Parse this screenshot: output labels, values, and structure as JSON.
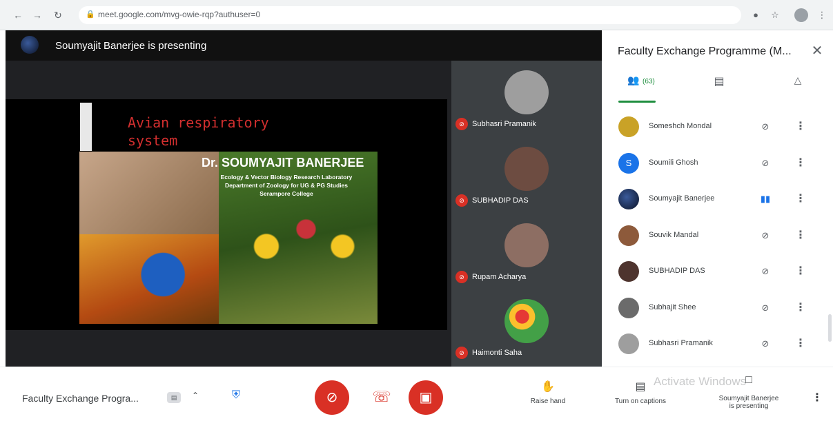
{
  "browser": {
    "url": "meet.google.com/mvg-owie-rqp?authuser=0",
    "back_icon": "arrow-left-icon",
    "forward_icon": "arrow-right-icon",
    "reload_icon": "reload-icon"
  },
  "stage": {
    "presenting_text": "Soumyajit Banerjee is presenting",
    "slide": {
      "title_line1": "Avian respiratory",
      "title_line2": "system",
      "presenter_name": "Dr. SOUMYAJIT  BANERJEE",
      "affiliation_line1": "Ecology & Vector Biology Research Laboratory",
      "affiliation_line2": "Department of Zoology for UG & PG Studies",
      "affiliation_line3": "Serampore College"
    }
  },
  "thumbnails": [
    {
      "name": "Subhasri Pramanik",
      "avatar_color": "#9e9e9e"
    },
    {
      "name": "SUBHADIP DAS",
      "avatar_color": "#6d4c41"
    },
    {
      "name": "Rupam Acharya",
      "avatar_color": "#8d6e63"
    },
    {
      "name": "Haimonti Saha",
      "avatar_color": "#43a047"
    }
  ],
  "panel": {
    "title": "Faculty Exchange Programme (M...",
    "tabs": {
      "people_count": "(63)",
      "people_icon": "people-icon",
      "chat_icon": "chat-icon",
      "activities_icon": "shapes-icon"
    },
    "participants": [
      {
        "name": "Someshch Mondal",
        "initial": "",
        "avatar_color": "#c9a227",
        "mic": "muted"
      },
      {
        "name": "Soumili Ghosh",
        "initial": "S",
        "avatar_color": "#1a73e8",
        "mic": "muted"
      },
      {
        "name": "Soumyajit Banerjee",
        "initial": "",
        "avatar_color": "#0b1326",
        "mic": "speaking"
      },
      {
        "name": "Souvik Mandal",
        "initial": "",
        "avatar_color": "#8d5a3b",
        "mic": "muted"
      },
      {
        "name": "SUBHADIP DAS",
        "initial": "",
        "avatar_color": "#4e342e",
        "mic": "muted"
      },
      {
        "name": "Subhajit Shee",
        "initial": "",
        "avatar_color": "#6b6b6b",
        "mic": "muted"
      },
      {
        "name": "Subhasri Pramanik",
        "initial": "",
        "avatar_color": "#9e9e9e",
        "mic": "muted"
      }
    ]
  },
  "bottom": {
    "meeting_title": "Faculty Exchange Progra...",
    "raise_hand_label": "Raise hand",
    "captions_label": "Turn on captions",
    "presenter_line1": "Soumyajit Banerjee",
    "presenter_line2": "is presenting",
    "watermark": "Activate Windows",
    "colors": {
      "red": "#d93025",
      "green": "#1e8e3e",
      "blue": "#1a73e8"
    }
  }
}
